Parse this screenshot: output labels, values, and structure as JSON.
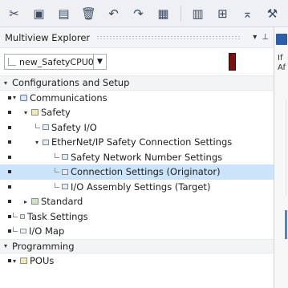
{
  "toolbar": {
    "buttons": [
      {
        "icon": "cut-icon",
        "glyph": "✂"
      },
      {
        "icon": "copy-icon",
        "glyph": "▣"
      },
      {
        "icon": "paste-icon",
        "glyph": "▤"
      },
      {
        "icon": "delete-icon",
        "glyph": "🗑"
      },
      {
        "icon": "undo-icon",
        "glyph": "↶"
      },
      {
        "icon": "redo-icon",
        "glyph": "↷"
      },
      {
        "icon": "save-icon",
        "glyph": "▦"
      },
      {
        "icon": "build-icon",
        "glyph": "▥"
      },
      {
        "icon": "online-icon",
        "glyph": "⊞"
      },
      {
        "icon": "transfer-icon",
        "glyph": "⌅"
      },
      {
        "icon": "tools-icon",
        "glyph": "⚒"
      }
    ]
  },
  "explorer": {
    "title": "Multiview Explorer",
    "pin_glyph": "▾ ⊥",
    "device": {
      "name": "new_SafetyCPU0",
      "arrow": "▼"
    },
    "tree": [
      {
        "type": "section",
        "label": "Configurations and Setup",
        "expander": "▾"
      },
      {
        "type": "item",
        "indent": 1,
        "expander": "▾",
        "icon": "communications-icon",
        "label": "Communications"
      },
      {
        "type": "item",
        "indent": 2,
        "expander": "▾",
        "icon": "safety-icon",
        "label": "Safety"
      },
      {
        "type": "item",
        "indent": 3,
        "expander": "",
        "icon": "safety-io-icon",
        "label": "Safety I/O"
      },
      {
        "type": "item",
        "indent": 3,
        "expander": "▾",
        "icon": "ethernet-ip-icon",
        "label": "EtherNet/IP Safety Connection Settings"
      },
      {
        "type": "item",
        "indent": 4,
        "expander": "",
        "icon": "network-number-icon",
        "label": "Safety Network Number Settings"
      },
      {
        "type": "item",
        "indent": 4,
        "expander": "",
        "icon": "connection-settings-icon",
        "label": "Connection Settings (Originator)",
        "selected": true
      },
      {
        "type": "item",
        "indent": 4,
        "expander": "",
        "icon": "assembly-settings-icon",
        "label": "I/O Assembly Settings (Target)"
      },
      {
        "type": "item",
        "indent": 2,
        "expander": "▸",
        "icon": "standard-icon",
        "label": "Standard"
      },
      {
        "type": "item",
        "indent": 1,
        "expander": "",
        "icon": "task-settings-icon",
        "label": "Task Settings"
      },
      {
        "type": "item",
        "indent": 1,
        "expander": "",
        "icon": "io-map-icon",
        "label": "I/O Map"
      },
      {
        "type": "section",
        "label": "Programming",
        "expander": "▾"
      },
      {
        "type": "item",
        "indent": 1,
        "expander": "▾",
        "icon": "pou-icon",
        "label": "POUs"
      }
    ]
  },
  "right_panel": {
    "text_line1": "If",
    "text_line2": "Af"
  }
}
